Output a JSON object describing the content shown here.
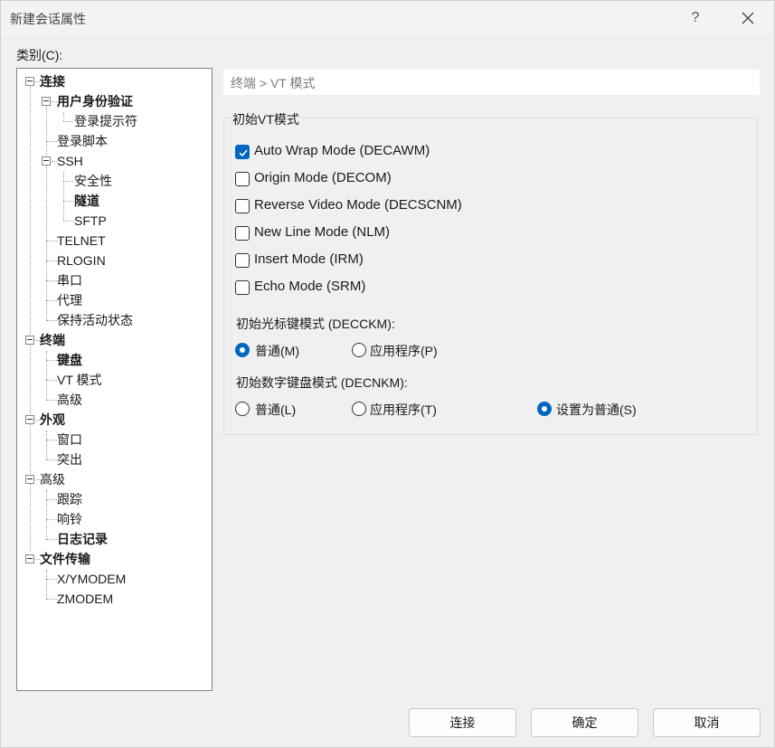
{
  "window": {
    "title": "新建会话属性",
    "help": "?"
  },
  "category_label": "类别(C):",
  "tree": {
    "connection": "连接",
    "auth": "用户身份验证",
    "login_prompt": "登录提示符",
    "login_script": "登录脚本",
    "ssh": "SSH",
    "security": "安全性",
    "tunnel": "隧道",
    "sftp": "SFTP",
    "telnet": "TELNET",
    "rlogin": "RLOGIN",
    "serial": "串口",
    "proxy": "代理",
    "keepalive": "保持活动状态",
    "terminal": "终端",
    "keyboard": "键盘",
    "vt_mode": "VT 模式",
    "advanced": "高级",
    "appearance": "外观",
    "window": "窗口",
    "highlight": "突出",
    "advanced2": "高级",
    "trace": "跟踪",
    "bell": "响铃",
    "logging": "日志记录",
    "file_transfer": "文件传输",
    "xymodem": "X/YMODEM",
    "zmodem": "ZMODEM"
  },
  "breadcrumb": "终端 > VT 模式",
  "group": {
    "title": "初始VT模式",
    "options": [
      {
        "label": "Auto Wrap Mode (DECAWM)",
        "checked": true
      },
      {
        "label": "Origin Mode (DECOM)",
        "checked": false
      },
      {
        "label": "Reverse Video Mode (DECSCNM)",
        "checked": false
      },
      {
        "label": "New Line Mode (NLM)",
        "checked": false
      },
      {
        "label": "Insert Mode (IRM)",
        "checked": false
      },
      {
        "label": "Echo Mode (SRM)",
        "checked": false
      }
    ],
    "cursor_key": {
      "label": "初始光标键模式 (DECCKM):",
      "normal": "普通(M)",
      "application": "应用程序(P)",
      "selected": "normal"
    },
    "keypad": {
      "label": "初始数字键盘模式 (DECNKM):",
      "normal": "普通(L)",
      "application": "应用程序(T)",
      "set_normal": "设置为普通(S)",
      "selected": "set_normal"
    }
  },
  "buttons": {
    "connect": "连接",
    "ok": "确定",
    "cancel": "取消"
  },
  "colors": {
    "accent": "#0067c0"
  }
}
